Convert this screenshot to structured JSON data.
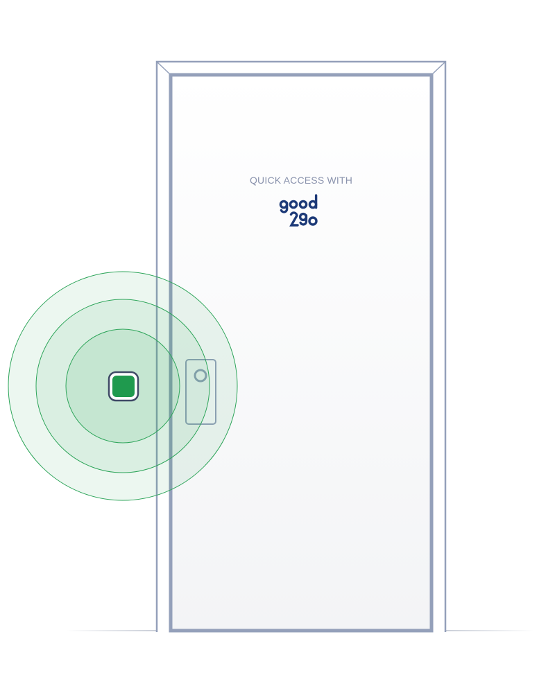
{
  "door": {
    "caption": "QUICK ACCESS WITH",
    "logo": {
      "word": "good2go",
      "color": "#1d3a78"
    }
  },
  "lock": {
    "key_color": "#1f9a4e",
    "ring_color": "#2ea55a"
  },
  "colors": {
    "frame": "#94a0ba",
    "door_fill": "#f7f8fa",
    "floor": "#c7ccd6"
  }
}
